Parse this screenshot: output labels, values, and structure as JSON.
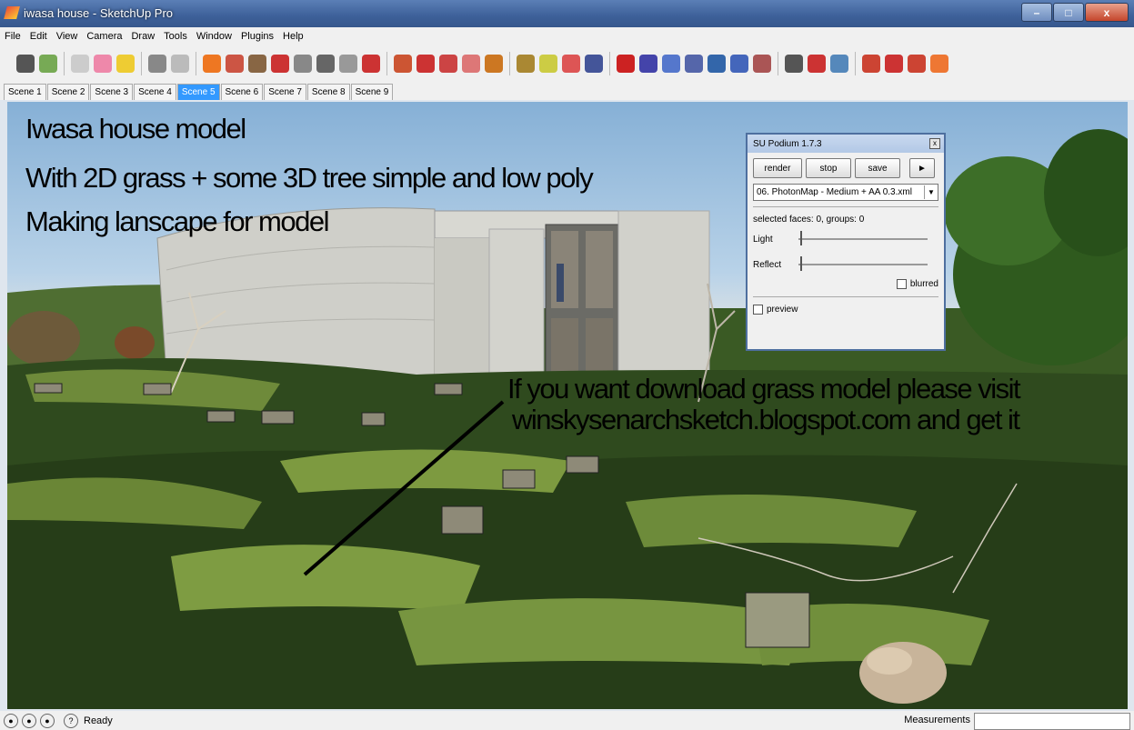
{
  "window": {
    "title": "iwasa house - SketchUp Pro",
    "minimize": "–",
    "maximize": "□",
    "close": "x"
  },
  "menu": [
    "File",
    "Edit",
    "View",
    "Camera",
    "Draw",
    "Tools",
    "Window",
    "Plugins",
    "Help"
  ],
  "toolbar_icons": [
    "podium-icon",
    "components-icon",
    "paint-icon",
    "materials-icon",
    "bulb-icon",
    "select-icon",
    "eraser-icon",
    "paint-bucket-icon",
    "rectangle-icon",
    "line-icon",
    "circle-icon",
    "arc-icon",
    "push-pull-icon",
    "follow-me-icon",
    "move-icon",
    "rotate-icon",
    "scale-icon",
    "offset-icon",
    "tape-icon",
    "protractor-icon",
    "dimension-icon",
    "text-icon",
    "axes-icon",
    "3d-text-icon",
    "orbit-icon",
    "pan-icon",
    "zoom-icon",
    "zoom-window-icon",
    "zoom-extents-icon",
    "previous-view-icon",
    "position-camera-icon",
    "walk-icon",
    "look-around-icon",
    "section-plane-icon",
    "extra-1-icon",
    "extra-2-icon",
    "extra-3-icon",
    "extra-4-icon"
  ],
  "scenes": [
    "Scene 1",
    "Scene 2",
    "Scene 3",
    "Scene 4",
    "Scene 5",
    "Scene 6",
    "Scene 7",
    "Scene 8",
    "Scene 9"
  ],
  "active_scene": "Scene 5",
  "overlay": {
    "line1": "Iwasa house model",
    "line2": "With 2D grass + some 3D tree simple and low poly",
    "line3": "Making lanscape for model",
    "line4": "If you want download grass model please visit",
    "line5": "winskysenarchsketch.blogspot.com and get it"
  },
  "podium": {
    "title": "SU Podium 1.7.3",
    "close": "x",
    "render": "render",
    "stop": "stop",
    "save": "save",
    "more": "►",
    "preset": "06. PhotonMap - Medium + AA 0.3.xml",
    "selected": "selected faces: 0, groups: 0",
    "light": "Light",
    "reflect": "Reflect",
    "blurred": "blurred",
    "preview": "preview"
  },
  "status": {
    "ready": "Ready",
    "help": "?",
    "measurements": "Measurements"
  },
  "colors": {
    "active_tab": "#3399ff",
    "titlebar": "#3d6099"
  }
}
